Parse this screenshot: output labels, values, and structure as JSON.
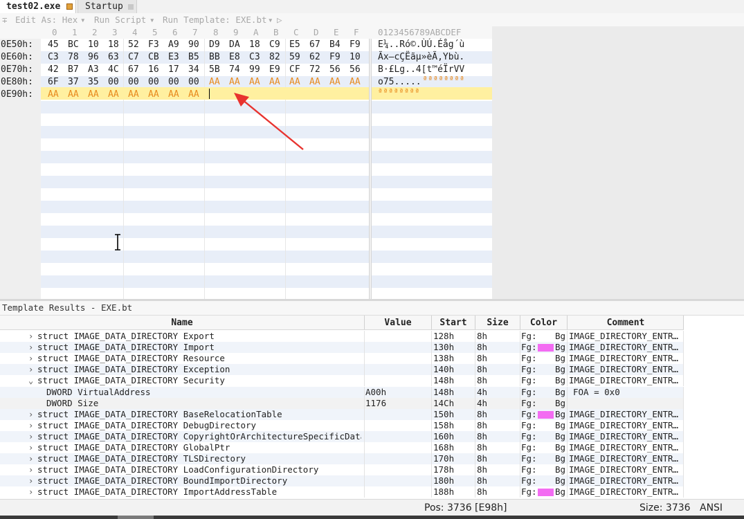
{
  "tabs": [
    {
      "label": "test02.exe",
      "active": true
    },
    {
      "label": "Startup",
      "active": false
    }
  ],
  "toolbar": {
    "pin_glyph": "∓",
    "edit_as": "Edit As: Hex",
    "run_script": "Run Script",
    "run_template": "Run Template: EXE.bt",
    "dropdown_glyph": "▾",
    "play_glyph": "▷"
  },
  "hex": {
    "column_headers": [
      "0",
      "1",
      "2",
      "3",
      "4",
      "5",
      "6",
      "7",
      "8",
      "9",
      "A",
      "B",
      "C",
      "D",
      "E",
      "F"
    ],
    "text_header": "0123456789ABCDEF",
    "rows": [
      {
        "address": "0E50h:",
        "bytes": [
          "45",
          "BC",
          "10",
          "18",
          "52",
          "F3",
          "A9",
          "90",
          "D9",
          "DA",
          "18",
          "C9",
          "E5",
          "67",
          "B4",
          "F9"
        ],
        "text": "E¼..Ró©.ÙÚ.Éåg´ù"
      },
      {
        "address": "0E60h:",
        "bytes": [
          "C3",
          "78",
          "96",
          "63",
          "C7",
          "CB",
          "E3",
          "B5",
          "BB",
          "E8",
          "C3",
          "82",
          "59",
          "62",
          "F9",
          "10"
        ],
        "text": "Ãx–cÇËãµ»èÃ‚Ybù."
      },
      {
        "address": "0E70h:",
        "bytes": [
          "42",
          "B7",
          "A3",
          "4C",
          "67",
          "16",
          "17",
          "34",
          "5B",
          "74",
          "99",
          "E9",
          "CF",
          "72",
          "56",
          "56"
        ],
        "text": "B·£Lg..4[t™éÏrVV"
      },
      {
        "address": "0E80h:",
        "bytes": [
          "6F",
          "37",
          "35",
          "00",
          "00",
          "00",
          "00",
          "00",
          "AA",
          "AA",
          "AA",
          "AA",
          "AA",
          "AA",
          "AA",
          "AA"
        ],
        "text": "o75.....",
        "text_pad": "ªªªªªªªª"
      },
      {
        "address": "0E90h:",
        "bytes": [
          "AA",
          "AA",
          "AA",
          "AA",
          "AA",
          "AA",
          "AA",
          "AA"
        ],
        "text": "",
        "text_pad": "ªªªªªªªª"
      }
    ]
  },
  "results": {
    "title": "Template Results - EXE.bt",
    "headers": {
      "name": "Name",
      "value": "Value",
      "start": "Start",
      "size": "Size",
      "color": "Color",
      "comment": "Comment"
    },
    "rows": [
      {
        "expander": "›",
        "name": "struct IMAGE_DATA_DIRECTORY Export",
        "value": "",
        "start": "128h",
        "size": "8h",
        "fg": "Fg:",
        "bg": "Bg",
        "swatch": false,
        "comment": "IMAGE_DIRECTORY_ENTR…"
      },
      {
        "expander": "›",
        "name": "struct IMAGE_DATA_DIRECTORY Import",
        "value": "",
        "start": "130h",
        "size": "8h",
        "fg": "Fg:",
        "bg": "Bg",
        "swatch": true,
        "comment": "IMAGE_DIRECTORY_ENTR…"
      },
      {
        "expander": "›",
        "name": "struct IMAGE_DATA_DIRECTORY Resource",
        "value": "",
        "start": "138h",
        "size": "8h",
        "fg": "Fg:",
        "bg": "Bg",
        "swatch": false,
        "comment": "IMAGE_DIRECTORY_ENTR…"
      },
      {
        "expander": "›",
        "name": "struct IMAGE_DATA_DIRECTORY Exception",
        "value": "",
        "start": "140h",
        "size": "8h",
        "fg": "Fg:",
        "bg": "Bg",
        "swatch": false,
        "comment": "IMAGE_DIRECTORY_ENTR…"
      },
      {
        "expander": "⌄",
        "name": "struct IMAGE_DATA_DIRECTORY Security",
        "value": "",
        "start": "148h",
        "size": "8h",
        "fg": "Fg:",
        "bg": "Bg",
        "swatch": false,
        "comment": "IMAGE_DIRECTORY_ENTR…"
      },
      {
        "expander": "",
        "name": "DWORD VirtualAddress",
        "value": "A00h",
        "start": "148h",
        "size": "4h",
        "fg": "Fg:",
        "bg": "Bg",
        "swatch": false,
        "comment": "FOA = 0x0",
        "child": true
      },
      {
        "expander": "",
        "name": "DWORD Size",
        "value": "1176",
        "start": "14Ch",
        "size": "4h",
        "fg": "Fg:",
        "bg": "Bg",
        "swatch": false,
        "comment": "",
        "child": true
      },
      {
        "expander": "›",
        "name": "struct IMAGE_DATA_DIRECTORY BaseRelocationTable",
        "value": "",
        "start": "150h",
        "size": "8h",
        "fg": "Fg:",
        "bg": "Bg",
        "swatch": true,
        "comment": "IMAGE_DIRECTORY_ENTR…"
      },
      {
        "expander": "›",
        "name": "struct IMAGE_DATA_DIRECTORY DebugDirectory",
        "value": "",
        "start": "158h",
        "size": "8h",
        "fg": "Fg:",
        "bg": "Bg",
        "swatch": false,
        "comment": "IMAGE_DIRECTORY_ENTR…"
      },
      {
        "expander": "›",
        "name": "struct IMAGE_DATA_DIRECTORY CopyrightOrArchitectureSpecificData",
        "value": "",
        "start": "160h",
        "size": "8h",
        "fg": "Fg:",
        "bg": "Bg",
        "swatch": false,
        "comment": "IMAGE_DIRECTORY_ENTR…"
      },
      {
        "expander": "›",
        "name": "struct IMAGE_DATA_DIRECTORY GlobalPtr",
        "value": "",
        "start": "168h",
        "size": "8h",
        "fg": "Fg:",
        "bg": "Bg",
        "swatch": false,
        "comment": "IMAGE_DIRECTORY_ENTR…"
      },
      {
        "expander": "›",
        "name": "struct IMAGE_DATA_DIRECTORY TLSDirectory",
        "value": "",
        "start": "170h",
        "size": "8h",
        "fg": "Fg:",
        "bg": "Bg",
        "swatch": false,
        "comment": "IMAGE_DIRECTORY_ENTR…"
      },
      {
        "expander": "›",
        "name": "struct IMAGE_DATA_DIRECTORY LoadConfigurationDirectory",
        "value": "",
        "start": "178h",
        "size": "8h",
        "fg": "Fg:",
        "bg": "Bg",
        "swatch": false,
        "comment": "IMAGE_DIRECTORY_ENTR…"
      },
      {
        "expander": "›",
        "name": "struct IMAGE_DATA_DIRECTORY BoundImportDirectory",
        "value": "",
        "start": "180h",
        "size": "8h",
        "fg": "Fg:",
        "bg": "Bg",
        "swatch": false,
        "comment": "IMAGE_DIRECTORY_ENTR…"
      },
      {
        "expander": "›",
        "name": "struct IMAGE_DATA_DIRECTORY ImportAddressTable",
        "value": "",
        "start": "188h",
        "size": "8h",
        "fg": "Fg:",
        "bg": "Bg",
        "swatch": true,
        "comment": "IMAGE_DIRECTORY_ENTR…"
      }
    ]
  },
  "status": {
    "pos": "Pos: 3736 [E98h]",
    "size": "Size: 3736",
    "encoding": "ANSI"
  },
  "colors": {
    "pad_byte": "#e88a1e",
    "cursor_line": "#fff0a0",
    "swatch": "#f36cf2",
    "annotation_arrow": "#e8332f"
  }
}
